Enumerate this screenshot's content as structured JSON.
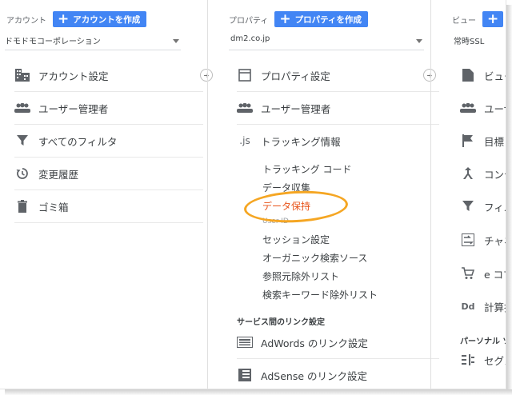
{
  "account": {
    "label": "アカウント",
    "create": "アカウントを作成",
    "selected": "ドモドモコーポレーション",
    "items": [
      "アカウント設定",
      "ユーザー管理者",
      "すべてのフィルタ",
      "変更履歴",
      "ゴミ箱"
    ]
  },
  "property": {
    "label": "プロパティ",
    "create": "プロパティを作成",
    "selected": "dm2.co.jp",
    "items": [
      "プロパティ設定",
      "ユーザー管理者",
      "トラッキング情報"
    ],
    "tracking_subitems": [
      "トラッキング コード",
      "データ収集",
      "データ保持",
      "User-ID",
      "セッション設定",
      "オーガニック検索ソース",
      "参照元除外リスト",
      "検索キーワード除外リスト"
    ],
    "section_label": "サービス間のリンク設定",
    "link_items": [
      "AdWords のリンク設定",
      "AdSense のリンク設定"
    ],
    "js_icon": ".js"
  },
  "view": {
    "label": "ビュー",
    "selected": "常時SSL",
    "items": [
      "ビュー",
      "ユーザ",
      "目標",
      "コンテ",
      "フィル",
      "チャネ",
      "e コマ",
      "計算指"
    ],
    "section_label": "パーソナル ツ",
    "last_item": "セグメ",
    "dd_icon": "Dd"
  },
  "colors": {
    "accent": "#4285f4",
    "highlight": "#f5a623",
    "active_text": "#e8541b"
  }
}
